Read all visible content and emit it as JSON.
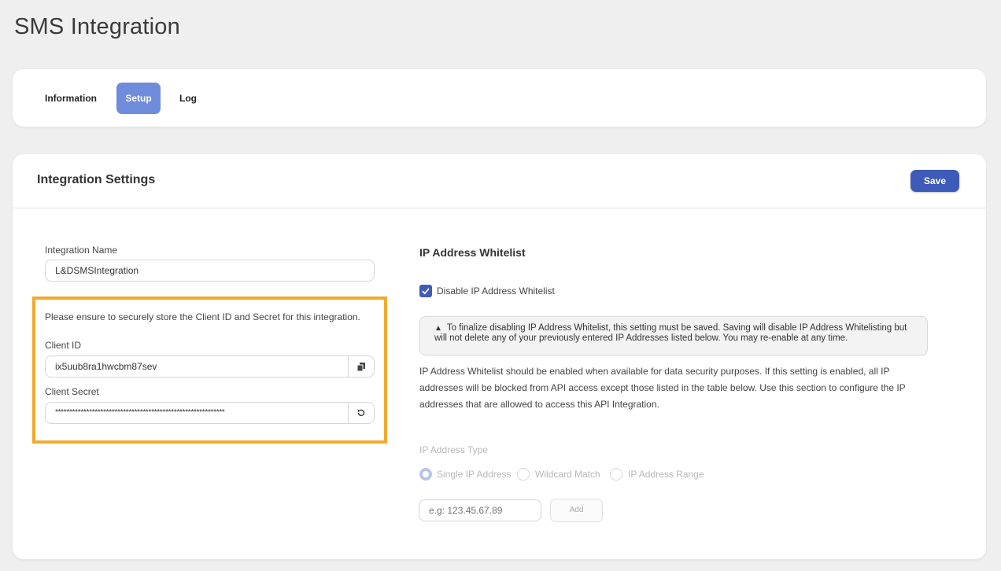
{
  "page": {
    "title": "SMS Integration"
  },
  "tabs": [
    {
      "label": "Information"
    },
    {
      "label": "Setup",
      "active": true
    },
    {
      "label": "Log"
    }
  ],
  "settings": {
    "title": "Integration Settings",
    "save_label": "Save",
    "integration_name": {
      "label": "Integration Name",
      "value": "L&DSMSIntegration"
    },
    "credentials": {
      "notice": "Please ensure to securely store the Client ID and Secret for this integration.",
      "client_id": {
        "label": "Client ID",
        "value": "ix5uub8ra1hwcbm87sev",
        "action_icon": "copy-icon"
      },
      "client_secret": {
        "label": "Client Secret",
        "value": "************************************************************",
        "action_icon": "refresh-icon"
      }
    },
    "whitelist": {
      "title": "IP Address Whitelist",
      "disable_checkbox": {
        "label": "Disable IP Address Whitelist",
        "checked": true
      },
      "warning": "To finalize disabling IP Address Whitelist, this setting must be saved. Saving will disable IP Address Whitelisting but will not delete any of your previously entered IP Addresses listed below. You may re-enable at any time.",
      "description": "IP Address Whitelist should be enabled when available for data security purposes. If this setting is enabled, all IP addresses will be blocked from API access except those listed in the table below. Use this section to configure the IP addresses that are allowed to access this API Integration.",
      "type_label": "IP Address Type",
      "types": [
        {
          "label": "Single IP Address",
          "selected": true
        },
        {
          "label": "Wildcard Match",
          "selected": false
        },
        {
          "label": "IP Address Range",
          "selected": false
        }
      ],
      "ip_input_placeholder": "e.g: 123.45.67.89",
      "add_label": "Add"
    }
  },
  "colors": {
    "accent": "#3e5bb9",
    "tab_active": "#6f8bdc",
    "highlight": "#f0ab2e"
  }
}
